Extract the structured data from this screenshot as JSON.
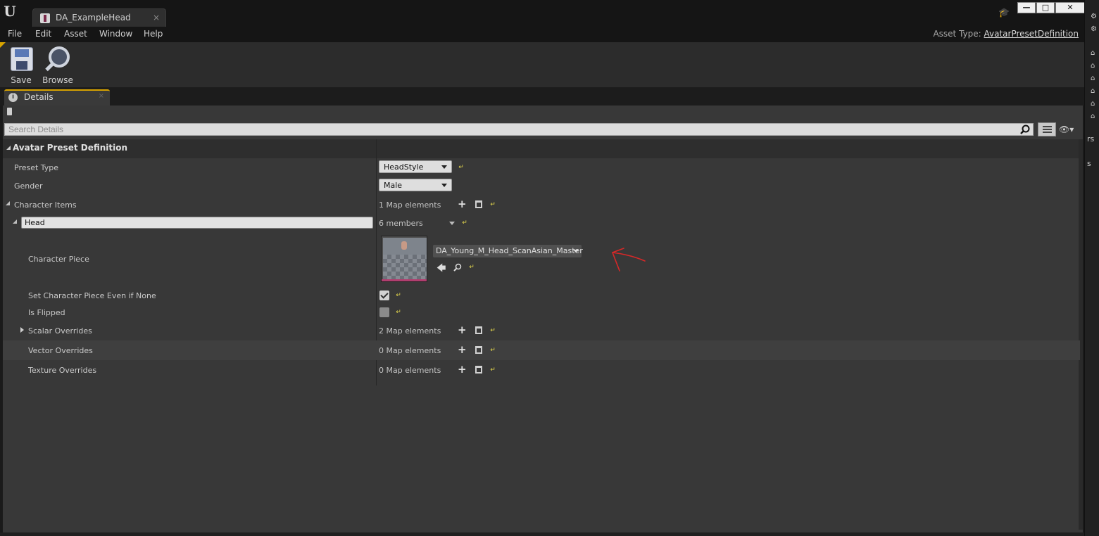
{
  "window": {
    "tab_title": "DA_ExampleHead",
    "close_glyph": "×",
    "minimize_glyph": "—",
    "maximize_glyph": "□",
    "window_close_glyph": "✕"
  },
  "menu": {
    "items": [
      "File",
      "Edit",
      "Asset",
      "Window",
      "Help"
    ],
    "asset_type_label": "Asset Type:",
    "asset_type_value": "AvatarPresetDefinition"
  },
  "toolbar": {
    "save_label": "Save",
    "browse_label": "Browse"
  },
  "details_tab": {
    "label": "Details",
    "close_glyph": "×"
  },
  "search": {
    "placeholder": "Search Details"
  },
  "category": {
    "title": "Avatar Preset Definition"
  },
  "properties": {
    "preset_type": {
      "label": "Preset Type",
      "value": "HeadStyle"
    },
    "gender": {
      "label": "Gender",
      "value": "Male"
    },
    "character_items": {
      "label": "Character Items",
      "count": "1 Map elements"
    },
    "head": {
      "key": "Head",
      "count": "6 members"
    },
    "character_piece": {
      "label": "Character Piece",
      "asset": "DA_Young_M_Head_ScanAsian_Master"
    },
    "set_even_if_none": {
      "label": "Set Character Piece Even if None",
      "checked": true
    },
    "is_flipped": {
      "label": "Is Flipped",
      "checked": false
    },
    "scalar_overrides": {
      "label": "Scalar Overrides",
      "count": "2 Map elements"
    },
    "vector_overrides": {
      "label": "Vector Overrides",
      "count": "0 Map elements"
    },
    "texture_overrides": {
      "label": "Texture Overrides",
      "count": "0 Map elements"
    }
  },
  "right_strip": {
    "text_1": "rs",
    "text_2": "s"
  },
  "colors": {
    "accent": "#d9a400",
    "reset_arrow": "#e6d94d",
    "annotation": "#d62828",
    "asset_bar": "#b13e6f"
  }
}
